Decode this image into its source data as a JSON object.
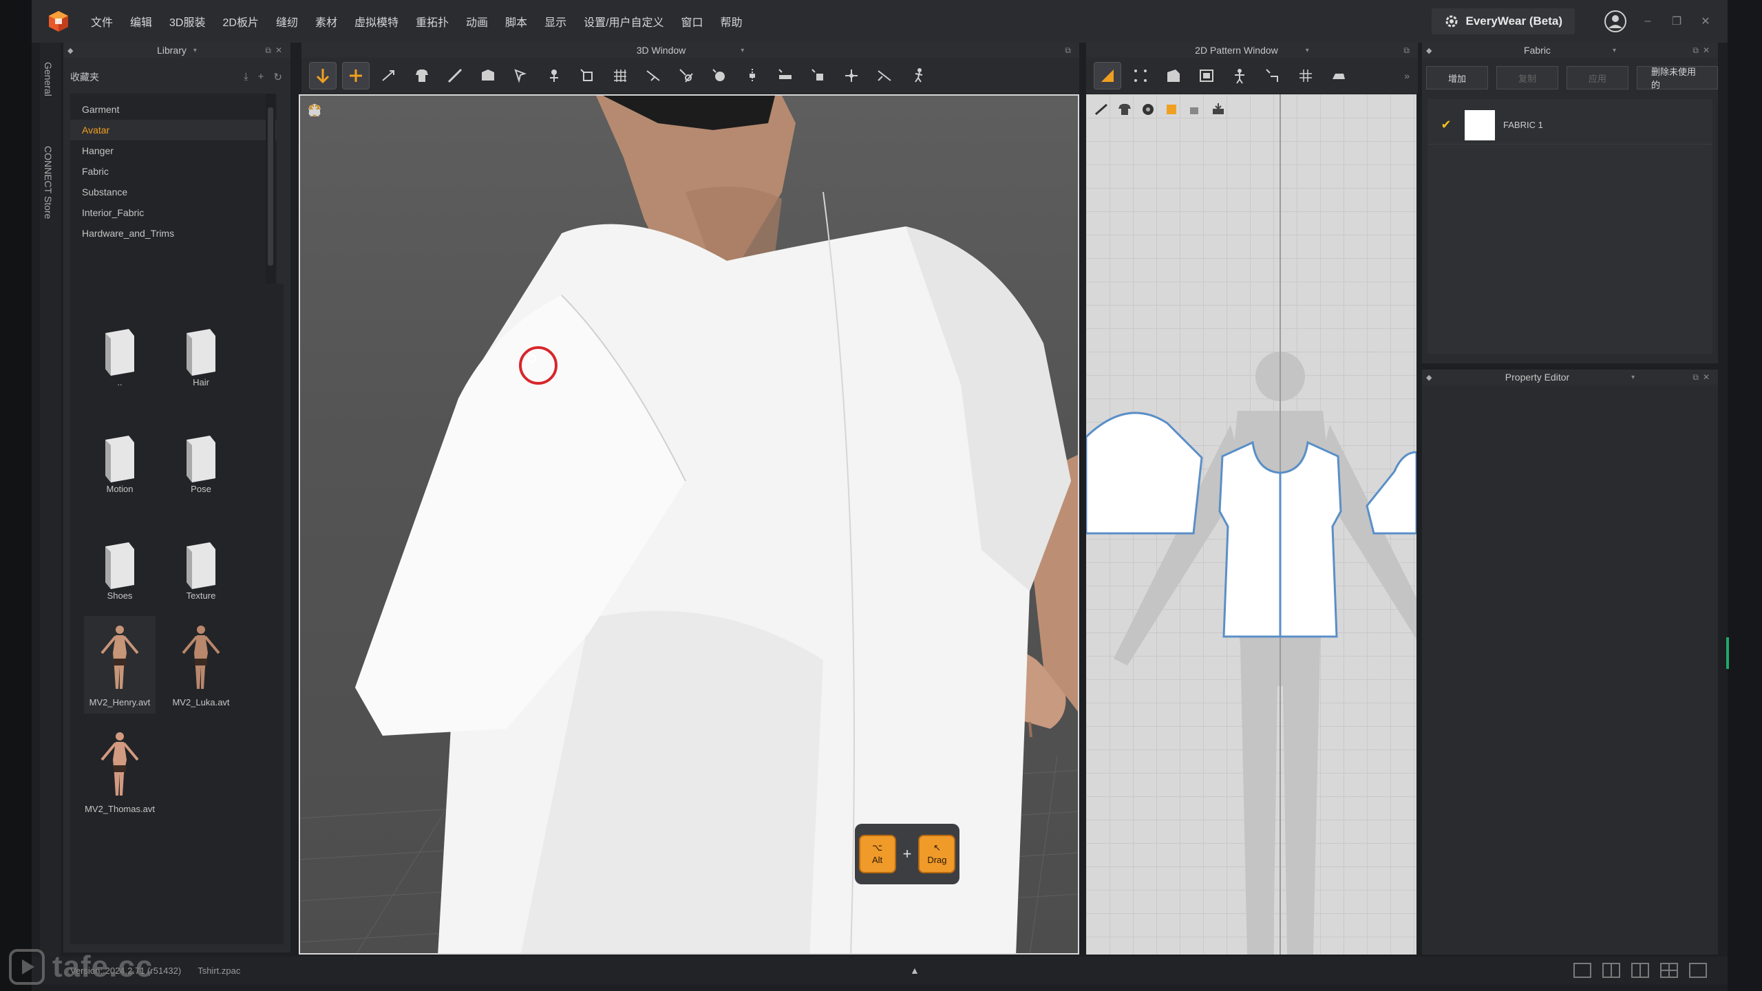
{
  "menu": {
    "items": [
      "文件",
      "编辑",
      "3D服装",
      "2D板片",
      "缝纫",
      "素材",
      "虚拟模特",
      "重拓扑",
      "动画",
      "脚本",
      "显示",
      "设置/用户自定义",
      "窗口",
      "帮助"
    ],
    "account_label": "EveryWear (Beta)"
  },
  "side_tabs": [
    "General",
    "CONNECT Store"
  ],
  "library": {
    "title": "Library",
    "favorites_label": "收藏夹",
    "tree": [
      "Garment",
      "Avatar",
      "Hanger",
      "Fabric",
      "Substance",
      "Interior_Fabric",
      "Hardware_and_Trims"
    ],
    "active_tree_item": "Avatar",
    "tiles": [
      {
        "label": "..",
        "kind": "folder"
      },
      {
        "label": "Hair",
        "kind": "folder"
      },
      {
        "label": "Motion",
        "kind": "folder"
      },
      {
        "label": "Pose",
        "kind": "folder"
      },
      {
        "label": "Shoes",
        "kind": "folder"
      },
      {
        "label": "Texture",
        "kind": "folder"
      },
      {
        "label": "MV2_Henry.avt",
        "kind": "avatar"
      },
      {
        "label": "MV2_Luka.avt",
        "kind": "avatar"
      },
      {
        "label": "MV2_Thomas.avt",
        "kind": "avatar"
      }
    ]
  },
  "window3d": {
    "title": "3D Window",
    "shortcut_keys": [
      {
        "symbol": "⌥",
        "label": "Alt"
      },
      {
        "symbol": "↖",
        "label": "Drag"
      }
    ],
    "shortcut_joiner": "+"
  },
  "window2d": {
    "title": "2D Pattern Window"
  },
  "fabric": {
    "title": "Fabric",
    "buttons": [
      "增加",
      "复制",
      "应用",
      "删除未使用的"
    ],
    "items": [
      {
        "name": "FABRIC 1",
        "checked": true,
        "color": "#ffffff"
      }
    ]
  },
  "property_editor": {
    "title": "Property Editor"
  },
  "status": {
    "version_label": "Version:",
    "version": "2024.2.71 (r51432)",
    "file": "Tshirt.zpac"
  },
  "watermark": "tafe.cc",
  "colors": {
    "accent": "#f0a020",
    "selection_ring": "#d8262b",
    "pattern_outline": "#5a8fc7",
    "status_green": "#1ea86a"
  }
}
